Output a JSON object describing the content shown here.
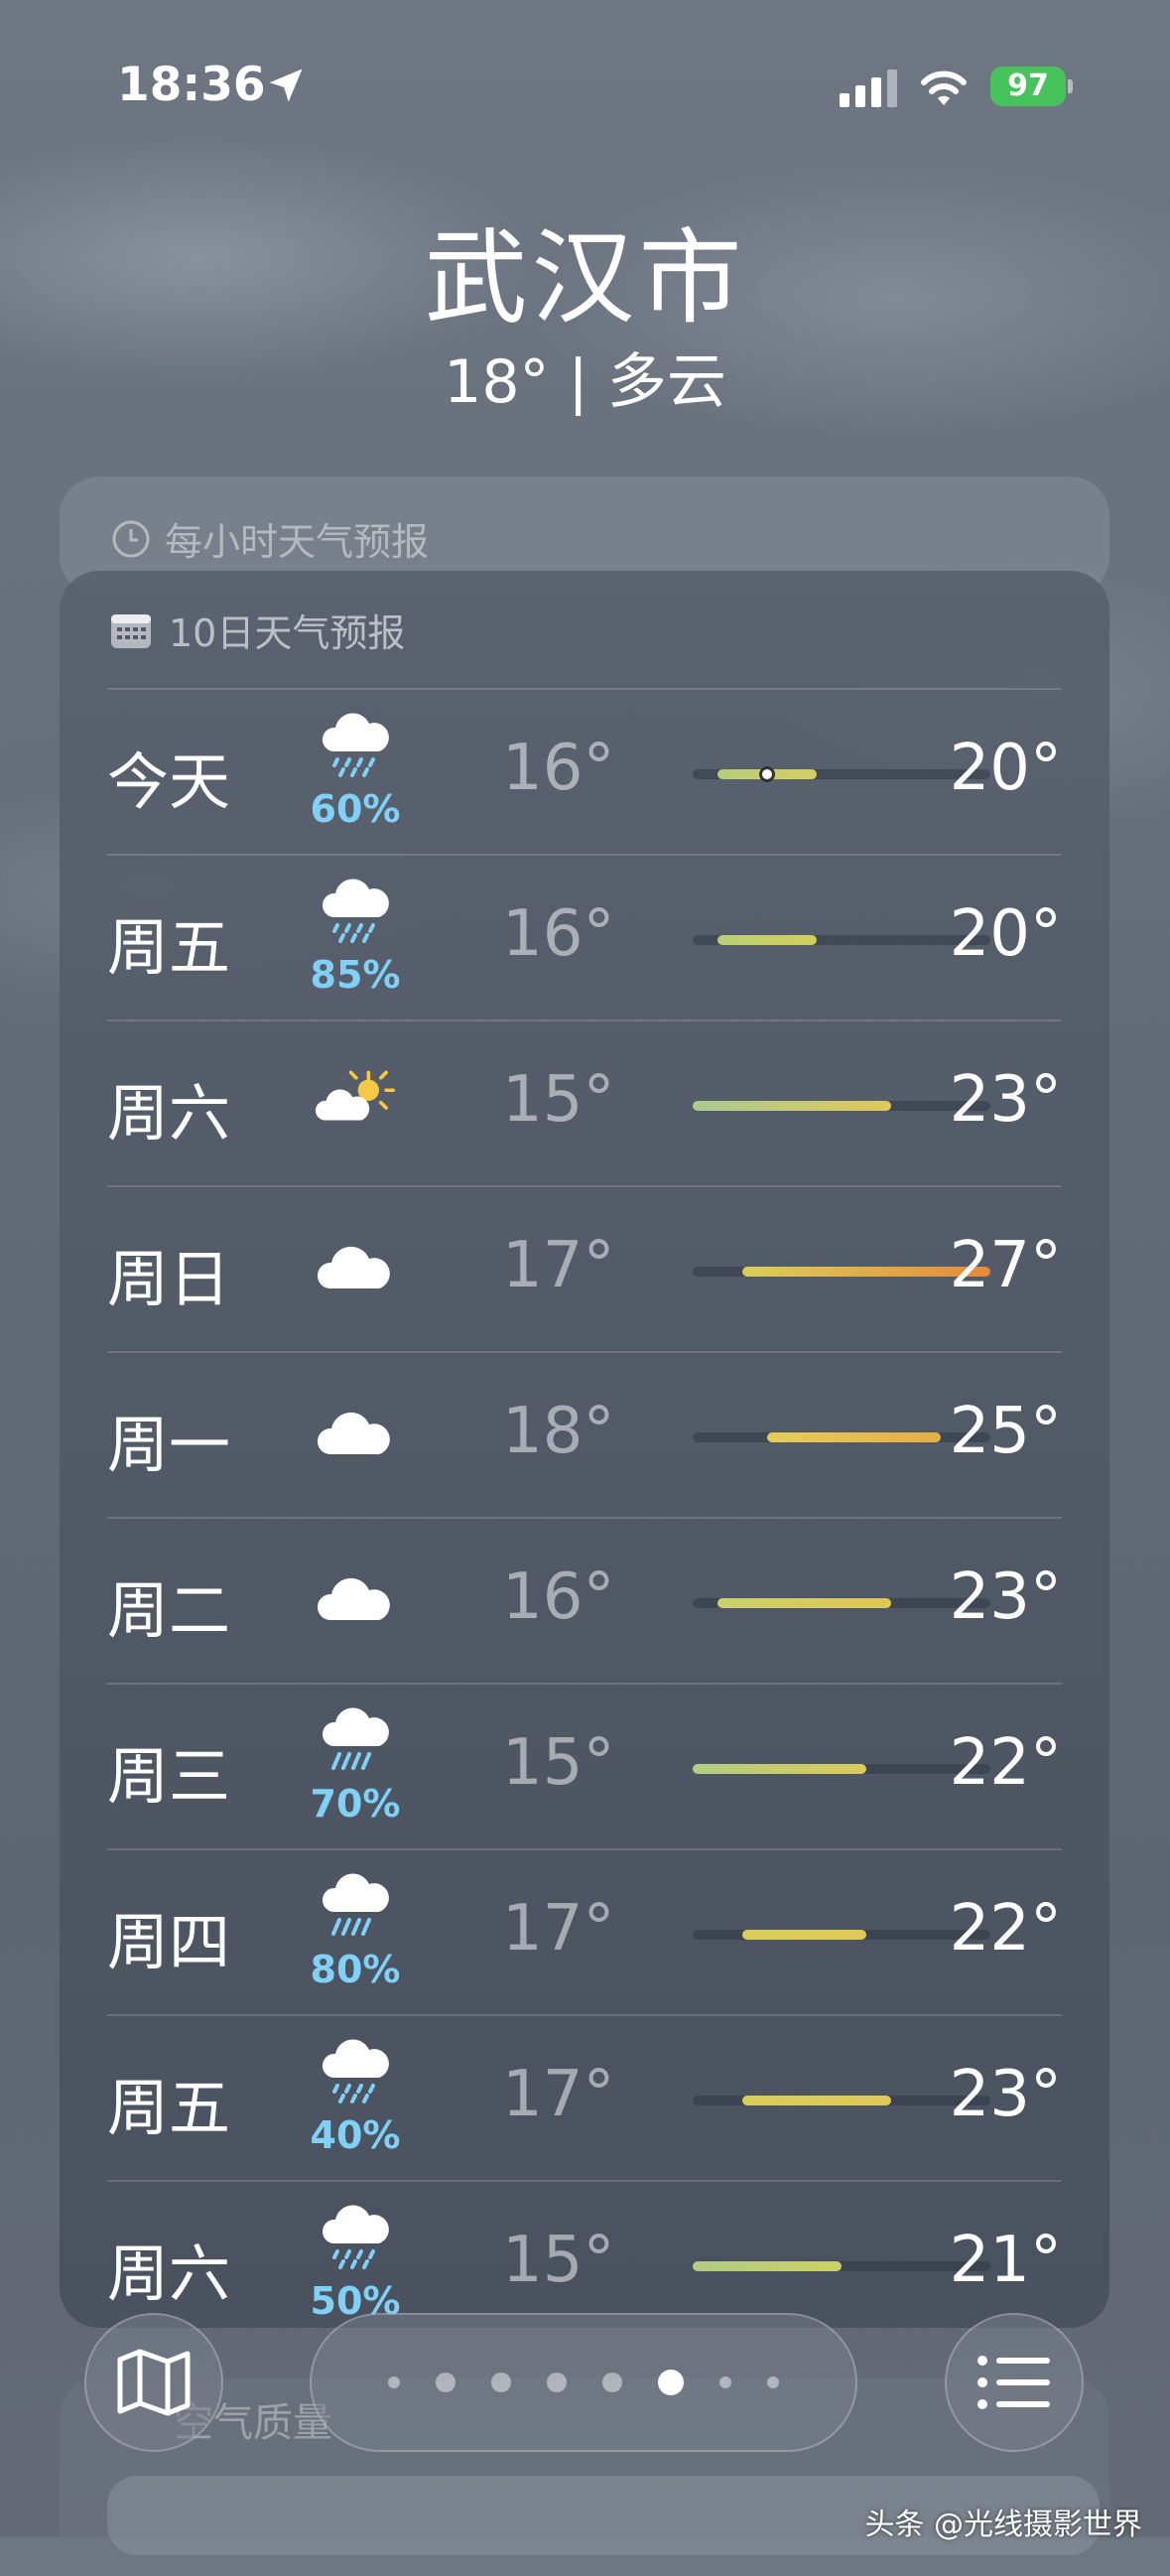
{
  "status_bar": {
    "time": "18:36",
    "battery": "97"
  },
  "header": {
    "city": "武汉市",
    "current": "18° | 多云"
  },
  "hourly": {
    "label": "每小时天气预报"
  },
  "forecast": {
    "title": "10日天气预报",
    "scale": {
      "min": 15,
      "max": 27
    },
    "days": [
      {
        "day": "今天",
        "icon": "cloud-drizzle-icon",
        "precip": "60%",
        "low": "16°",
        "high": "20°",
        "low_v": 16,
        "high_v": 20,
        "current_v": 18,
        "colors": [
          "#b6cd7a",
          "#d6cf5e"
        ]
      },
      {
        "day": "周五",
        "icon": "cloud-drizzle-icon",
        "precip": "85%",
        "low": "16°",
        "high": "20°",
        "low_v": 16,
        "high_v": 20,
        "colors": [
          "#b9cf78",
          "#d4ce5d"
        ]
      },
      {
        "day": "周六",
        "icon": "sun-behind-cloud-icon",
        "precip": "",
        "low": "15°",
        "high": "23°",
        "low_v": 15,
        "high_v": 23,
        "colors": [
          "#a9cb90",
          "#e2c85a"
        ]
      },
      {
        "day": "周日",
        "icon": "cloud-icon",
        "precip": "",
        "low": "17°",
        "high": "27°",
        "low_v": 17,
        "high_v": 27,
        "colors": [
          "#d9cf5a",
          "#e58a3a"
        ]
      },
      {
        "day": "周一",
        "icon": "cloud-icon",
        "precip": "",
        "low": "18°",
        "high": "25°",
        "low_v": 18,
        "high_v": 25,
        "colors": [
          "#e3cf55",
          "#e6ae44"
        ]
      },
      {
        "day": "周二",
        "icon": "cloud-icon",
        "precip": "",
        "low": "16°",
        "high": "23°",
        "low_v": 16,
        "high_v": 23,
        "colors": [
          "#c8d26c",
          "#e3c654"
        ]
      },
      {
        "day": "周三",
        "icon": "cloud-rain-icon",
        "precip": "70%",
        "low": "15°",
        "high": "22°",
        "low_v": 15,
        "high_v": 22,
        "colors": [
          "#b3cd82",
          "#dcca58"
        ]
      },
      {
        "day": "周四",
        "icon": "cloud-rain-icon",
        "precip": "80%",
        "low": "17°",
        "high": "22°",
        "low_v": 17,
        "high_v": 22,
        "colors": [
          "#d8ce5a",
          "#e0c955"
        ]
      },
      {
        "day": "周五",
        "icon": "cloud-drizzle-icon",
        "precip": "40%",
        "low": "17°",
        "high": "23°",
        "low_v": 17,
        "high_v": 23,
        "colors": [
          "#d8ce5a",
          "#e2c855"
        ]
      },
      {
        "day": "周六",
        "icon": "cloud-drizzle-icon",
        "precip": "50%",
        "low": "15°",
        "high": "21°",
        "low_v": 15,
        "high_v": 21,
        "colors": [
          "#b1cc86",
          "#ccd064"
        ]
      }
    ]
  },
  "air_quality": {
    "label": "空气质量"
  },
  "pager": {
    "dots": 8,
    "active": 5
  },
  "watermark": "头条 @光线摄影世界"
}
